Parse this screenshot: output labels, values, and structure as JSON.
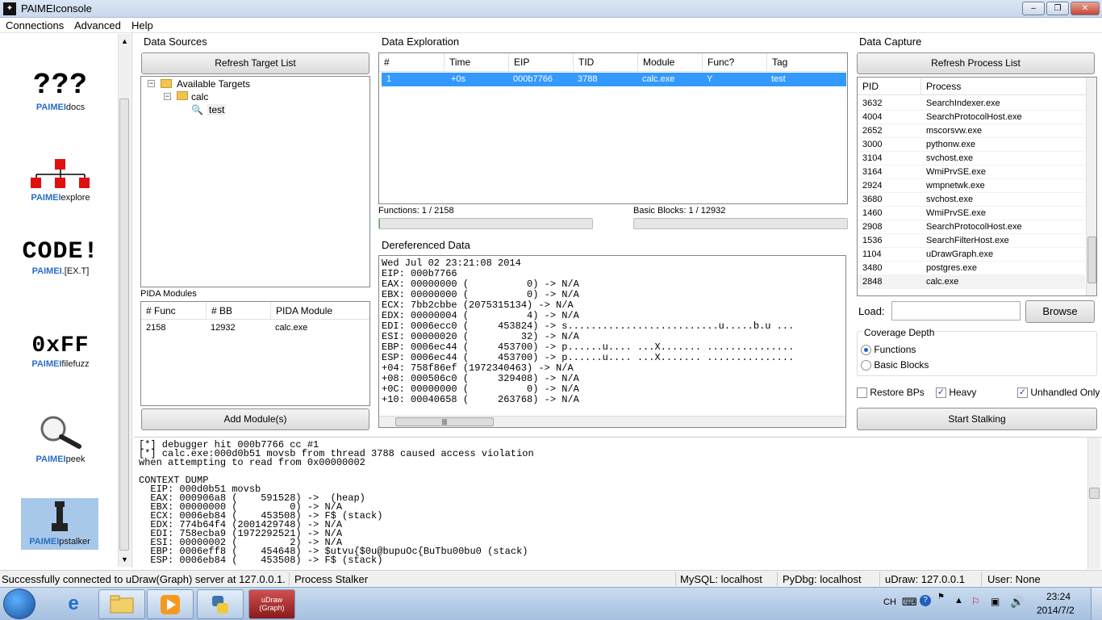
{
  "window": {
    "title": "PAIMEIconsole",
    "icon": "paimei-icon",
    "controls": [
      "minimize-icon",
      "maximize-icon",
      "close-icon"
    ],
    "control_glyphs": [
      "‒",
      "❐",
      "✕"
    ]
  },
  "menu": [
    "Connections",
    "Advanced",
    "Help"
  ],
  "sidebar": {
    "tools": [
      {
        "glyph": "???",
        "label_bold": "PAIMEI",
        "label_rest": "docs"
      },
      {
        "glyph": "",
        "label_bold": "PAIMEI",
        "label_rest": "explore"
      },
      {
        "glyph": "CODE!",
        "label_bold": "PAIMEI",
        "label_rest": ".[EX.T]"
      },
      {
        "glyph": "0xFF",
        "label_bold": "PAIMEI",
        "label_rest": "filefuzz"
      },
      {
        "glyph": "",
        "label_bold": "PAIMEI",
        "label_rest": "peek"
      },
      {
        "glyph": "",
        "label_bold": "PAIMEI",
        "label_rest": "pstalker"
      }
    ]
  },
  "data_sources": {
    "title": "Data Sources",
    "refresh_button": "Refresh Target List",
    "tree": {
      "root": "Available Targets",
      "child": "calc",
      "leaf": "test"
    },
    "pida_title": "PIDA Modules",
    "pida_columns": [
      "# Func",
      "# BB",
      "PIDA Module"
    ],
    "pida_rows": [
      [
        "2158",
        "12932",
        "calc.exe"
      ]
    ],
    "add_button": "Add Module(s)"
  },
  "data_exploration": {
    "title": "Data Exploration",
    "columns": [
      "#",
      "Time",
      "EIP",
      "TID",
      "Module",
      "Func?",
      "Tag"
    ],
    "rows": [
      [
        "1",
        "+0s",
        "000b7766",
        "3788",
        "calc.exe",
        "Y",
        "test"
      ]
    ],
    "functions_label": "Functions: 1 / 2158",
    "blocks_label": "Basic Blocks: 1 / 12932",
    "functions_progress": 0.0005,
    "blocks_progress": 0.0001
  },
  "dereferenced": {
    "title": "Dereferenced Data",
    "lines": [
      "Wed Jul 02 23:21:08 2014",
      "EIP: 000b7766",
      "EAX: 00000000 (          0) -> N/A",
      "EBX: 00000000 (          0) -> N/A",
      "ECX: 7bb2cbbe (2075315134) -> N/A",
      "EDX: 00000004 (          4) -> N/A",
      "EDI: 0006ecc0 (     453824) -> s..........................u.....b.u ...",
      "ESI: 00000020 (         32) -> N/A",
      "EBP: 0006ec44 (     453700) -> p......u.... ...X....... ...............",
      "ESP: 0006ec44 (     453700) -> p......u.... ...X....... ...............",
      "+04: 758f86ef (1972340463) -> N/A",
      "+08: 000506c0 (     329408) -> N/A",
      "+0C: 00000000 (          0) -> N/A",
      "+10: 00040658 (     263768) -> N/A"
    ]
  },
  "data_capture": {
    "title": "Data Capture",
    "refresh_button": "Refresh Process List",
    "columns": [
      "PID",
      "Process"
    ],
    "processes": [
      [
        "3632",
        "SearchIndexer.exe"
      ],
      [
        "4004",
        "SearchProtocolHost.exe"
      ],
      [
        "2652",
        "mscorsvw.exe"
      ],
      [
        "3000",
        "pythonw.exe"
      ],
      [
        "3104",
        "svchost.exe"
      ],
      [
        "3164",
        "WmiPrvSE.exe"
      ],
      [
        "2924",
        "wmpnetwk.exe"
      ],
      [
        "3680",
        "svchost.exe"
      ],
      [
        "1460",
        "WmiPrvSE.exe"
      ],
      [
        "2908",
        "SearchProtocolHost.exe"
      ],
      [
        "1536",
        "SearchFilterHost.exe"
      ],
      [
        "1104",
        "uDrawGraph.exe"
      ],
      [
        "3480",
        "postgres.exe"
      ],
      [
        "2848",
        "calc.exe"
      ]
    ],
    "load_label": "Load:",
    "load_value": "",
    "browse_button": "Browse",
    "coverage_title": "Coverage Depth",
    "coverage_options": [
      "Functions",
      "Basic Blocks"
    ],
    "coverage_selected": "Functions",
    "checks": [
      {
        "label": "Restore BPs",
        "checked": false
      },
      {
        "label": "Heavy",
        "checked": true
      },
      {
        "label": "Unhandled Only",
        "checked": true
      }
    ],
    "start_button": "Start Stalking"
  },
  "log": {
    "lines": [
      "[*] debugger hit 000b7766 cc #1",
      "[*] calc.exe:000d0b51 movsb from thread 3788 caused access violation",
      "when attempting to read from 0x00000002",
      "",
      "CONTEXT DUMP",
      "  EIP: 000d0b51 movsb",
      "  EAX: 000906a8 (    591528) ->  (heap)",
      "  EBX: 00000000 (         0) -> N/A",
      "  ECX: 0006eb84 (    453508) -> F$ (stack)",
      "  EDX: 774b64f4 (2001429748) -> N/A",
      "  EDI: 758ecba9 (1972292521) -> N/A",
      "  ESI: 00000002 (         2) -> N/A",
      "  EBP: 0006eff8 (    454648) -> $utvu{$0u@bupuOc{BuTbu00bu0 (stack)",
      "  ESP: 0006eb84 (    453508) -> F$ (stack)"
    ]
  },
  "status": {
    "message": "Successfully connected to uDraw(Graph) server at 127.0.0.1.",
    "module": "Process Stalker",
    "mysql": "MySQL: localhost",
    "pydbg": "PyDbg: localhost",
    "udraw": "uDraw: 127.0.0.1",
    "user": "User: None"
  },
  "taskbar": {
    "apps": [
      "ie-icon",
      "explorer-icon",
      "media-player-icon",
      "python-icon",
      "udraw-icon"
    ],
    "udraw_label": "uDraw (Graph)",
    "tray_lang": "CH",
    "time": "23:24",
    "date": "2014/7/2"
  }
}
